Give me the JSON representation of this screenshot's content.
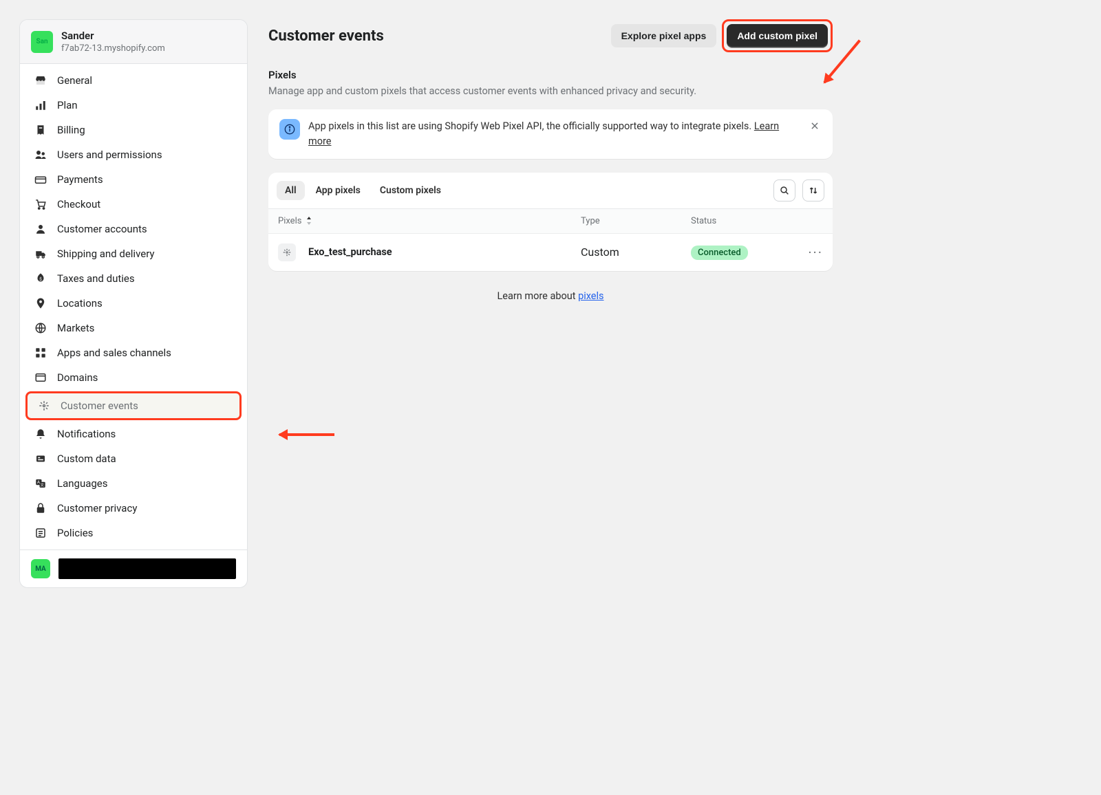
{
  "shop": {
    "avatar_label": "San",
    "name": "Sander",
    "domain": "f7ab72-13.myshopify.com"
  },
  "nav": {
    "items": [
      {
        "label": "General",
        "icon": "store"
      },
      {
        "label": "Plan",
        "icon": "plan"
      },
      {
        "label": "Billing",
        "icon": "billing"
      },
      {
        "label": "Users and permissions",
        "icon": "users"
      },
      {
        "label": "Payments",
        "icon": "payments"
      },
      {
        "label": "Checkout",
        "icon": "checkout"
      },
      {
        "label": "Customer accounts",
        "icon": "person"
      },
      {
        "label": "Shipping and delivery",
        "icon": "shipping"
      },
      {
        "label": "Taxes and duties",
        "icon": "taxes"
      },
      {
        "label": "Locations",
        "icon": "location"
      },
      {
        "label": "Markets",
        "icon": "markets"
      },
      {
        "label": "Apps and sales channels",
        "icon": "apps"
      },
      {
        "label": "Domains",
        "icon": "domains"
      },
      {
        "label": "Customer events",
        "icon": "pixel",
        "active": true
      },
      {
        "label": "Notifications",
        "icon": "bell"
      },
      {
        "label": "Custom data",
        "icon": "data"
      },
      {
        "label": "Languages",
        "icon": "lang"
      },
      {
        "label": "Customer privacy",
        "icon": "lock"
      },
      {
        "label": "Policies",
        "icon": "policies"
      }
    ]
  },
  "footer": {
    "avatar": "MA"
  },
  "page": {
    "title": "Customer events",
    "explore_btn": "Explore pixel apps",
    "add_btn": "Add custom pixel",
    "section_title": "Pixels",
    "section_desc": "Manage app and custom pixels that access customer events with enhanced privacy and security.",
    "info_text": "App pixels in this list are using Shopify Web Pixel API, the officially supported way to integrate pixels. ",
    "info_link": "Learn more",
    "tabs": [
      "All",
      "App pixels",
      "Custom pixels"
    ],
    "columns": {
      "pixels": "Pixels",
      "type": "Type",
      "status": "Status"
    },
    "rows": [
      {
        "name": "Exo_test_purchase",
        "type": "Custom",
        "status": "Connected"
      }
    ],
    "footer_text": "Learn more about ",
    "footer_link": "pixels"
  }
}
